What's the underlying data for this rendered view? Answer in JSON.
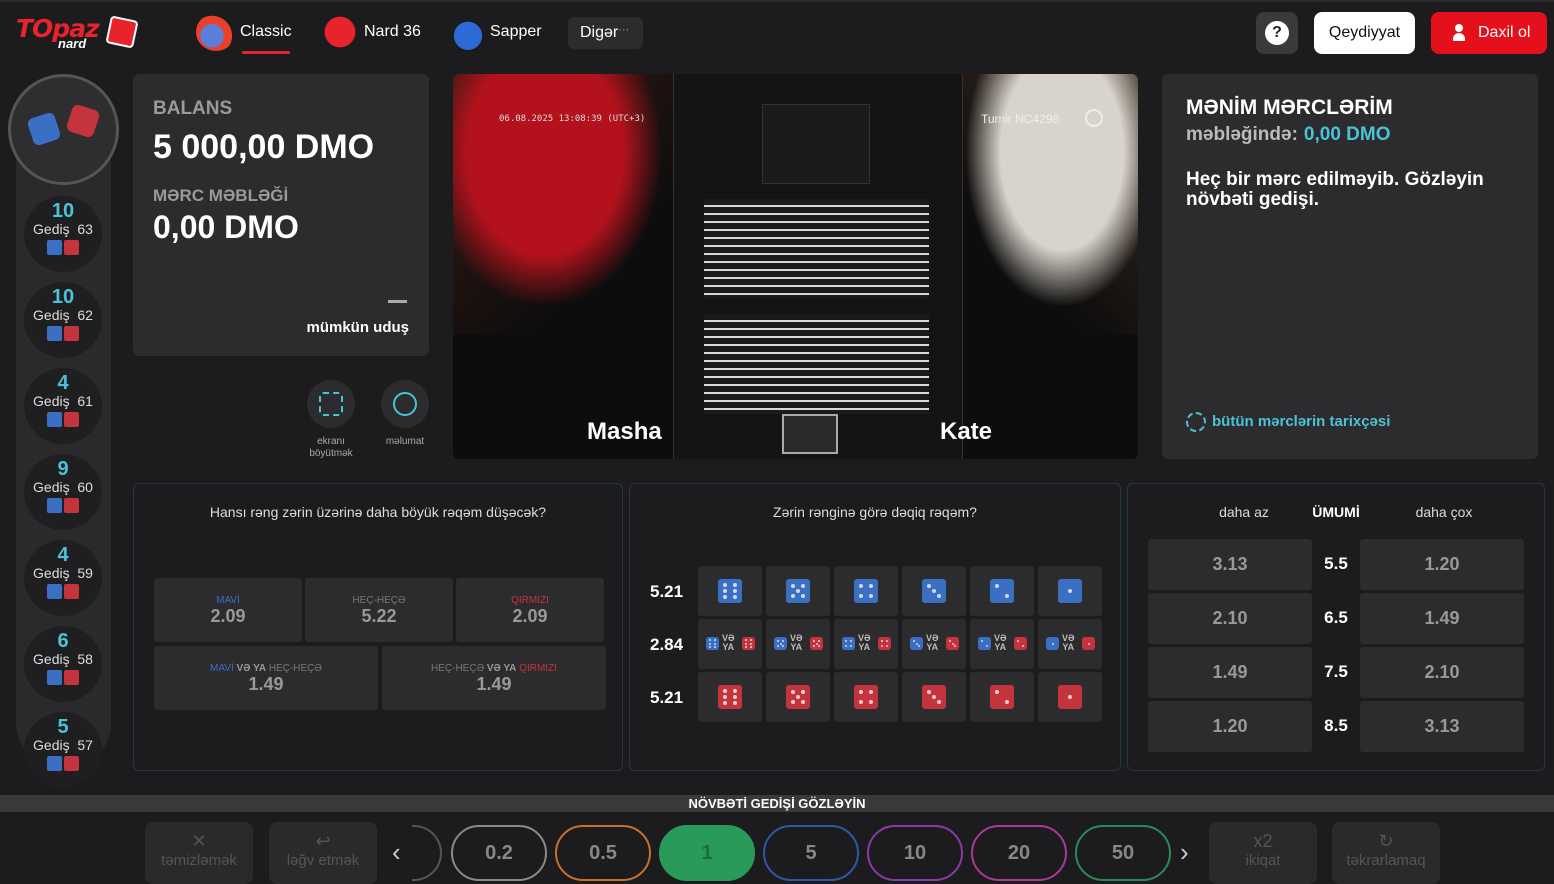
{
  "header": {
    "logo_main": "TOpaz",
    "logo_sub": "nard",
    "nav": [
      {
        "label": "Classic",
        "active": true
      },
      {
        "label": "Nard 36",
        "active": false
      },
      {
        "label": "Sapper",
        "active": false
      }
    ],
    "more_label": "Digər",
    "more_suffix": "···",
    "help_glyph": "?",
    "register_label": "Qeydiyyat",
    "login_label": "Daxil ol"
  },
  "history": [
    {
      "num": "10",
      "label": "Gediş",
      "game": "63",
      "dice": [
        "blue",
        "red"
      ]
    },
    {
      "num": "10",
      "label": "Gediş",
      "game": "62",
      "dice": [
        "blue",
        "red"
      ]
    },
    {
      "num": "4",
      "label": "Gediş",
      "game": "61",
      "dice": [
        "blue",
        "red"
      ]
    },
    {
      "num": "9",
      "label": "Gediş",
      "game": "60",
      "dice": [
        "blue",
        "red"
      ]
    },
    {
      "num": "4",
      "label": "Gediş",
      "game": "59",
      "dice": [
        "blue",
        "red"
      ]
    },
    {
      "num": "6",
      "label": "Gediş",
      "game": "58",
      "dice": [
        "blue",
        "red"
      ]
    },
    {
      "num": "5",
      "label": "Gediş",
      "game": "57",
      "dice": [
        "blue",
        "red"
      ]
    }
  ],
  "balance": {
    "label": "BALANS",
    "value": "5 000,00 DMO",
    "bet_label": "MƏRC MƏBLƏĞİ",
    "bet_value": "0,00 DMO",
    "win_dash": "—",
    "win_label": "mümkün uduş"
  },
  "controls": {
    "fullscreen_label_1": "ekranı",
    "fullscreen_label_2": "böyütmək",
    "info_label": "məlumat"
  },
  "video": {
    "timestamp": "06.08.2025 13:08:39 (UTC+3)",
    "tournament": "Turnir NC4298",
    "player_left": "Masha",
    "player_right": "Kate"
  },
  "my_bets": {
    "title": "MƏNİM MƏRCLƏRİM",
    "amount_label": "məbləğində:",
    "amount_value": "0,00 DMO",
    "message": "Heç bir mərc edilməyib. Gözləyin növbəti gedişi.",
    "history_link": "bütün mərclərin tarixçəsi"
  },
  "color_bets": {
    "title": "Hansı rəng zərin üzərinə daha böyük rəqəm düşəcək?",
    "cells": [
      {
        "sub": "MAVİ",
        "odd": "2.09",
        "color": "#3a6fc4"
      },
      {
        "sub": "HEÇ-HEÇƏ",
        "odd": "5.22",
        "color": "#777777"
      },
      {
        "sub": "QIRMIZI",
        "odd": "2.09",
        "color": "#c4343c"
      }
    ],
    "combo": [
      {
        "a": "MAVİ",
        "mid": "VƏ YA",
        "b": "HEÇ-HEÇƏ",
        "odd": "1.49"
      },
      {
        "a": "HEÇ-HEÇƏ",
        "mid": "VƏ YA",
        "b": "QIRMIZI",
        "odd": "1.49"
      }
    ]
  },
  "exact_bets": {
    "title": "Zərin rənginə görə dəqiq rəqəm?",
    "row_odds": [
      "5.21",
      "2.84",
      "5.21"
    ],
    "or_label": "VƏ",
    "or_label2": "YA",
    "faces": [
      6,
      5,
      4,
      3,
      2,
      1
    ]
  },
  "total_bets": {
    "less_label": "daha az",
    "total_label": "ÜMUMİ",
    "more_label": "daha çox",
    "rows": [
      {
        "less": "3.13",
        "total": "5.5",
        "more": "1.20"
      },
      {
        "less": "2.10",
        "total": "6.5",
        "more": "1.49"
      },
      {
        "less": "1.49",
        "total": "7.5",
        "more": "2.10"
      },
      {
        "less": "1.20",
        "total": "8.5",
        "more": "3.13"
      }
    ]
  },
  "bottom": {
    "wait_label": "NÖVBƏTİ GEDİŞİ GÖZLƏYİN",
    "clear_icon": "✕",
    "clear_label": "təmizləmək",
    "undo_icon": "↩",
    "undo_label": "ləğv etmək",
    "double_icon": "x2",
    "double_label": "ikiqat",
    "repeat_icon": "↻",
    "repeat_label": "təkrarlamaq",
    "prev_glyph": "‹",
    "next_glyph": "›",
    "chips": [
      {
        "value": "0.2",
        "color": "#8a8a8c"
      },
      {
        "value": "0.5",
        "color": "#c8702c"
      },
      {
        "value": "1",
        "color": "#2a9a5a",
        "selected": true
      },
      {
        "value": "5",
        "color": "#2c5aa8"
      },
      {
        "value": "10",
        "color": "#8a3aa8"
      },
      {
        "value": "20",
        "color": "#a83a9a"
      },
      {
        "value": "50",
        "color": "#2a8a5a"
      }
    ]
  }
}
